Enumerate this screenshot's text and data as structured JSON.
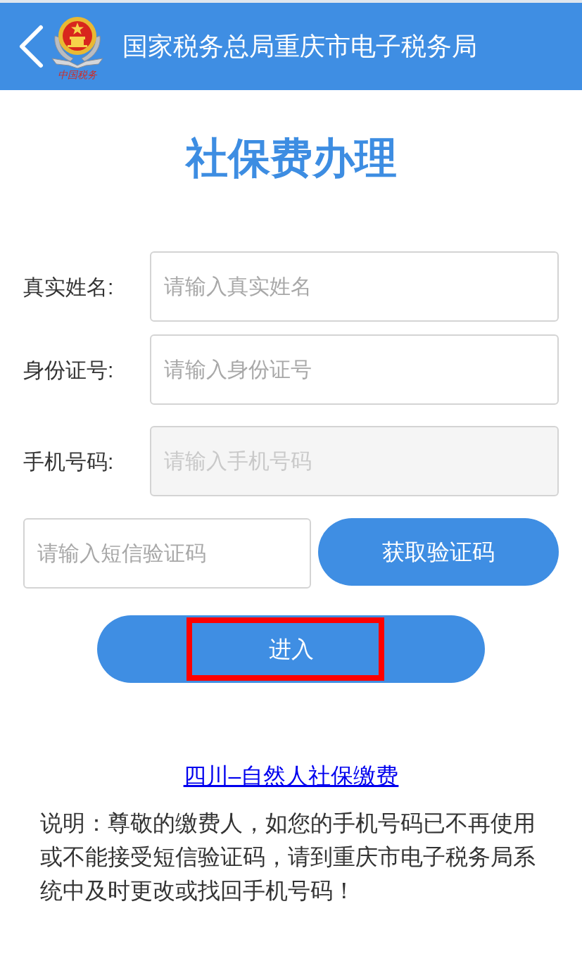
{
  "header": {
    "title": "国家税务总局重庆市电子税务局",
    "logo_caption": "中国税务"
  },
  "page_title": "社保费办理",
  "form": {
    "fields": [
      {
        "label": "真实姓名:",
        "placeholder": "请输入真实姓名",
        "disabled": false
      },
      {
        "label": "身份证号:",
        "placeholder": "请输入身份证号",
        "disabled": false
      },
      {
        "label": "手机号码:",
        "placeholder": "请输入手机号码",
        "disabled": true
      }
    ],
    "sms": {
      "placeholder": "请输入短信验证码",
      "button": "获取验证码"
    },
    "submit": {
      "label": "进入",
      "highlighted": true
    }
  },
  "link": "四川–自然人社保缴费",
  "note": "说明：尊敬的缴费人，如您的手机号码已不再使用或不能接受短信验证码，请到重庆市电子税务局系统中及时更改或找回手机号码！"
}
